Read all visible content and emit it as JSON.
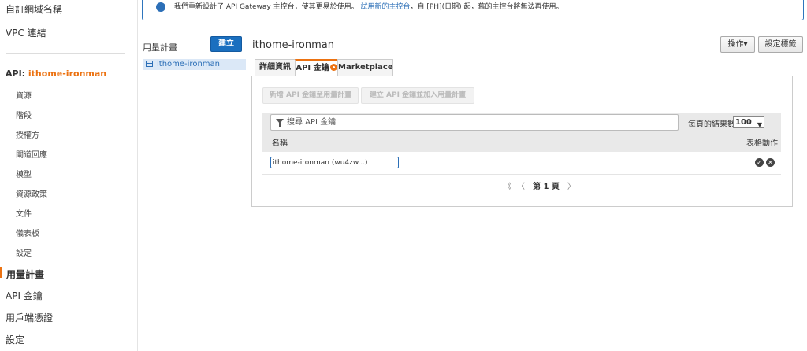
{
  "banner": {
    "text": "我們重新設計了 API Gateway 主控台，使其更易於使用。",
    "link": "試用新的主控台",
    "text_after": "，自 [PH](日期) 起，舊的主控台將無法再使用。"
  },
  "sidebar": {
    "top_items": [
      "自訂網域名稱",
      "VPC 連結"
    ],
    "api_prefix": "API: ",
    "api_name": "ithome-ironman",
    "sub_items": [
      "資源",
      "階段",
      "授權方",
      "閘道回應",
      "模型",
      "資源政策",
      "文件",
      "儀表板",
      "設定"
    ],
    "bottom_items": [
      "用量計畫",
      "API 金鑰",
      "用戶端憑證",
      "設定"
    ],
    "active": "用量計畫"
  },
  "plans": {
    "title": "用量計畫",
    "create_label": "建立",
    "items": [
      "ithome-ironman"
    ]
  },
  "main": {
    "title": "ithome-ironman",
    "actions_label": "操作▾",
    "tags_label": "設定標籤",
    "tabs": [
      "詳細資訊",
      "API 金鑰",
      "Marketplace"
    ],
    "active_tab": "API 金鑰",
    "btn_add_key": "新增 API 金鑰至用量計畫",
    "btn_create_key": "建立 API 金鑰並加入用量計畫",
    "search_placeholder": "搜尋 API 金鑰",
    "per_page_label": "每頁的結果數",
    "per_page_value": "100",
    "col_name": "名稱",
    "col_actions": "表格動作",
    "rows": [
      {
        "name": "ithome-ironman (wu4zw...)"
      }
    ],
    "pager": {
      "first": "《",
      "prev": "〈",
      "page": "第 1 頁",
      "next": "〉"
    }
  },
  "colors": {
    "accent": "#ec7211",
    "link": "#2c6fb7",
    "primary_button": "#1a6fbf"
  }
}
